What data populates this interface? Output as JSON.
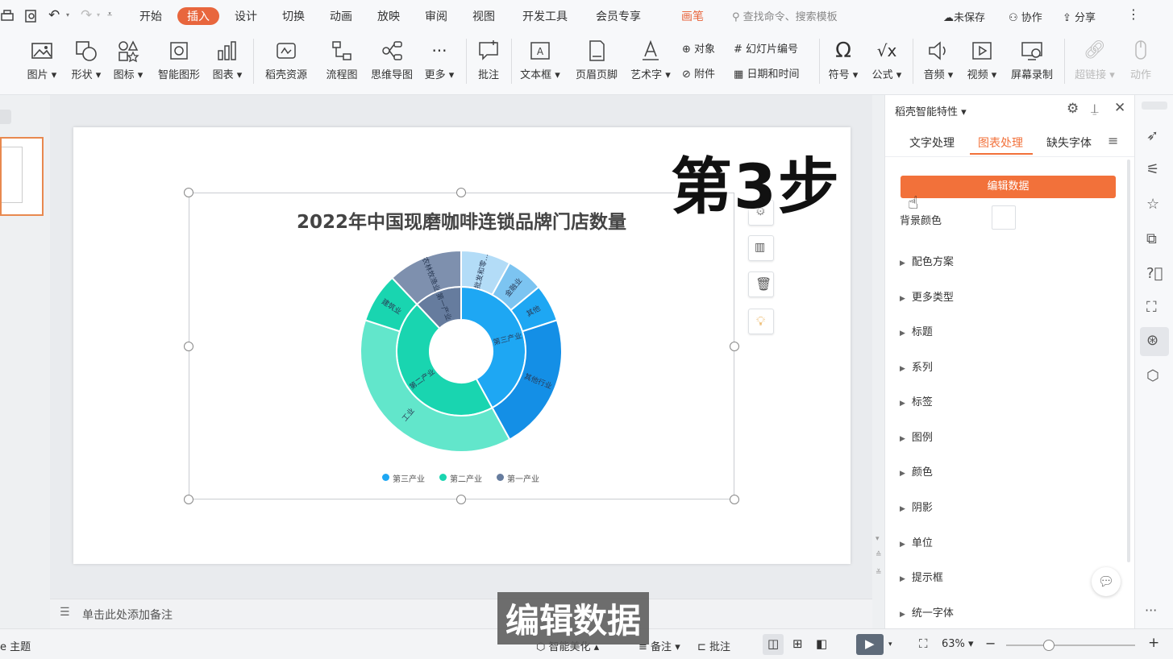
{
  "menu": {
    "tabs": [
      "开始",
      "插入",
      "设计",
      "切换",
      "动画",
      "放映",
      "审阅",
      "视图",
      "开发工具",
      "会员专享",
      "画笔"
    ],
    "active_tab": "插入",
    "search_placeholder": "查找命令、搜索模板",
    "unsaved": "未保存",
    "collab": "协作",
    "share": "分享"
  },
  "ribbon": {
    "picture": "图片",
    "shape": "形状",
    "icon": "图标",
    "smart_shape": "智能图形",
    "chart": "图表",
    "docer_resource": "稻壳资源",
    "flowchart": "流程图",
    "mindmap": "思维导图",
    "more": "更多",
    "comment": "批注",
    "textbox": "文本框",
    "header_footer": "页眉页脚",
    "wordart": "艺术字",
    "object": "对象",
    "attachment": "附件",
    "slide_number": "幻灯片编号",
    "datetime": "日期和时间",
    "symbol": "符号",
    "formula": "公式",
    "audio": "音频",
    "video": "视频",
    "screen_record": "屏幕录制",
    "hyperlink": "超链接",
    "action": "动作"
  },
  "chart_data": {
    "type": "sunburst",
    "title": "2022年中国现磨咖啡连锁品牌门店数量",
    "legend": [
      "第三产业",
      "第二产业",
      "第一产业"
    ],
    "legend_placement": "bottom",
    "inner_ring": [
      {
        "label": "第三产业",
        "value": 0.42
      },
      {
        "label": "第二产业",
        "value": 0.46
      },
      {
        "label": "第一产业",
        "value": 0.12
      }
    ],
    "outer_ring": [
      {
        "label": "批发和零...",
        "parent": "第三产业",
        "value": 0.08
      },
      {
        "label": "金融业",
        "parent": "第三产业",
        "value": 0.06
      },
      {
        "label": "其他",
        "parent": "第三产业",
        "value": 0.06
      },
      {
        "label": "其他行业",
        "parent": "第三产业",
        "value": 0.22
      },
      {
        "label": "工业",
        "parent": "第二产业",
        "value": 0.38
      },
      {
        "label": "建筑业",
        "parent": "第二产业",
        "value": 0.08
      },
      {
        "label": "农林牧渔业",
        "parent": "第一产业",
        "value": 0.12
      }
    ],
    "colors": [
      "#1ea7f3",
      "#19d5b0",
      "#667c9e"
    ]
  },
  "chart_tools": {
    "icons": [
      "chart-element-icon",
      "chart-data-icon",
      "delete-icon",
      "idea-icon"
    ]
  },
  "right_panel": {
    "title": "稻壳智能特性",
    "tabs": [
      "文字处理",
      "图表处理",
      "缺失字体"
    ],
    "active_tab": "图表处理",
    "edit_data_button": "编辑数据",
    "bg_color_label": "背景颜色",
    "sections": [
      "配色方案",
      "更多类型",
      "标题",
      "系列",
      "标签",
      "图例",
      "颜色",
      "阴影",
      "单位",
      "提示框",
      "统一字体"
    ],
    "accent": "#f2713a"
  },
  "notes_placeholder": "单击此处添加备注",
  "overlay": {
    "step": "第3步",
    "caption": "编辑数据"
  },
  "statusbar": {
    "theme": "主题",
    "beautify": "智能美化",
    "notes": "备注",
    "comment": "批注",
    "zoom": "63%"
  }
}
